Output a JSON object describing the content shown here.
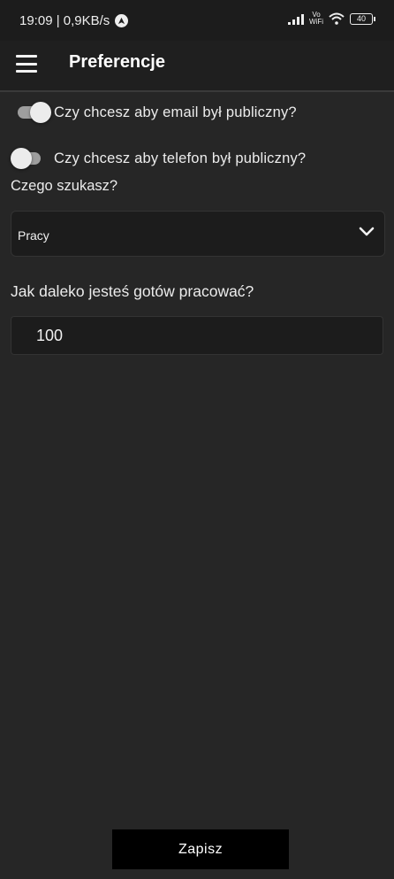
{
  "status_bar": {
    "time_speed": "19:09 | 0,9KB/s",
    "vowifi_top": "Vo",
    "vowifi_bottom": "WiFi",
    "battery": "40"
  },
  "app_bar": {
    "title": "Preferencje"
  },
  "preferences": {
    "email_public_label": "Czy chcesz aby email był publiczny?",
    "email_public_on": false,
    "phone_public_label": "Czy chcesz aby telefon był publiczny?",
    "phone_public_on": false,
    "looking_for_label": "Czego szukasz?",
    "looking_for_value": "Pracy",
    "distance_label": "Jak daleko jesteś gotów pracować?",
    "distance_value": "100"
  },
  "actions": {
    "save_label": "Zapisz"
  }
}
